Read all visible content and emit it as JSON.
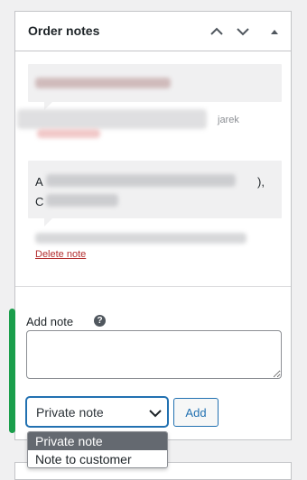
{
  "panel": {
    "title": "Order notes"
  },
  "header_buttons": {
    "move_up_icon": "chevron-up-icon",
    "move_down_icon": "chevron-down-icon",
    "toggle_icon": "caret-up-icon"
  },
  "notes": [
    {
      "meta_fragment": "jarek",
      "delete_label": ""
    },
    {
      "line1_start": "A",
      "line1_end": "),",
      "line2_start": "C",
      "line2_end": "",
      "delete_label": "Delete note"
    }
  ],
  "add_note": {
    "label": "Add note",
    "help_glyph": "?",
    "textarea_value": "",
    "note_type_selected": "Private note",
    "note_type_options": [
      "Private note",
      "Note to customer"
    ],
    "add_button_label": "Add"
  },
  "colors": {
    "accent": "#2271b1",
    "delete": "#b32d2e",
    "highlight_bar": "#1a9e4b",
    "selected_option_bg": "#646970"
  }
}
